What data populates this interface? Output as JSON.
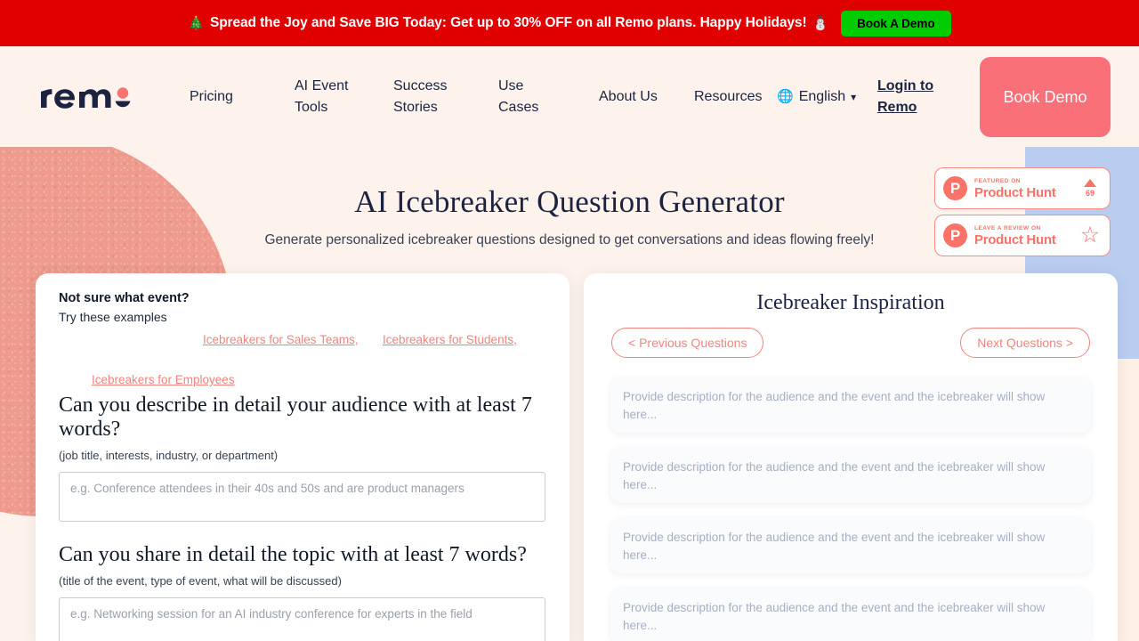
{
  "promo": {
    "emoji_left": "🎄",
    "text": "Spread the Joy and Save BIG Today: Get up to 30% OFF on all Remo plans. Happy Holidays!",
    "emoji_right": "⛄",
    "button_label": "Book A Demo",
    "bg_color": "#e00000",
    "button_color": "#00cc00"
  },
  "nav": {
    "logo_text": "remo",
    "links": [
      {
        "label": "Pricing"
      },
      {
        "label": "AI Event Tools"
      },
      {
        "label": "Success Stories"
      },
      {
        "label": "Use Cases"
      },
      {
        "label": "About Us"
      },
      {
        "label": "Resources"
      }
    ],
    "language": {
      "label": "English",
      "chevron": "⌄",
      "globe": "🌐"
    },
    "login_label": "Login to Remo",
    "cta_label": "Book Demo",
    "cta_color": "#f97078"
  },
  "hero": {
    "title": "AI Icebreaker Question Generator",
    "subtitle": "Generate personalized icebreaker questions designed to get conversations and ideas flowing freely!"
  },
  "product_hunt": [
    {
      "kicker": "FEATURED ON",
      "name": "Product Hunt",
      "logo_letter": "P",
      "upvotes": "69",
      "right_icon": "upvote-arrow-icon"
    },
    {
      "kicker": "LEAVE A REVIEW ON",
      "name": "Product Hunt",
      "logo_letter": "P",
      "star": "☆",
      "right_icon": "star-icon"
    }
  ],
  "left_panel": {
    "not_sure_heading": "Not sure what event?",
    "try_label": "Try these examples",
    "examples": [
      {
        "label": "Icebreakers for Sales Teams,"
      },
      {
        "label": "Icebreakers for Students,"
      },
      {
        "label": "Icebreakers for Employees"
      }
    ],
    "questions": [
      {
        "title": "Can you describe in detail your audience with at least 7 words?",
        "hint": "(job title, interests, industry, or department)",
        "placeholder": "e.g. Conference attendees in their 40s and 50s and are product managers",
        "value": ""
      },
      {
        "title": "Can you share in detail the topic with at least 7 words?",
        "hint": "(title of the event, type of event, what will be discussed)",
        "placeholder": "e.g. Networking session for an AI industry conference for experts in the field",
        "value": ""
      }
    ]
  },
  "right_panel": {
    "title": "Icebreaker Inspiration",
    "prev_label": "< Previous Questions",
    "next_label": "Next Questions >",
    "cards": [
      {
        "text": "Provide description for the audience and the event and the icebreaker will show here..."
      },
      {
        "text": "Provide description for the audience and the event and the icebreaker will show here..."
      },
      {
        "text": "Provide description for the audience and the event and the icebreaker will show here..."
      },
      {
        "text": "Provide description for the audience and the event and the icebreaker will show here..."
      }
    ]
  }
}
